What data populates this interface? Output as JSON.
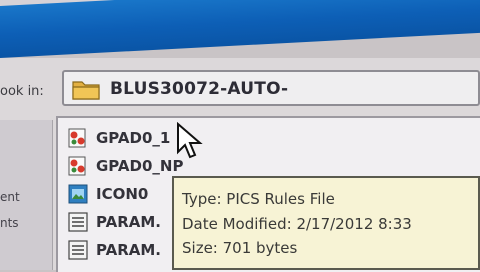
{
  "dialog": {
    "look_in_label": "ook in:",
    "path": "BLUS30072-AUTO-"
  },
  "places": [
    "ent",
    "nts"
  ],
  "files": [
    {
      "name": "GPAD0_1",
      "icon": "pics-rules-icon"
    },
    {
      "name": "GPAD0_NP",
      "icon": "pics-rules-icon"
    },
    {
      "name": "ICON0",
      "icon": "image-file-icon"
    },
    {
      "name": "PARAM.",
      "icon": "document-file-icon"
    },
    {
      "name": "PARAM.",
      "icon": "document-file-icon"
    }
  ],
  "tooltip": {
    "type": "Type: PICS Rules File",
    "date": "Date Modified: 2/17/2012 8:33",
    "size": "Size: 701 bytes"
  },
  "colors": {
    "titlebar": "#0d5fb6",
    "tooltip_bg": "#f7f3d5",
    "folder": "#e3b042"
  }
}
